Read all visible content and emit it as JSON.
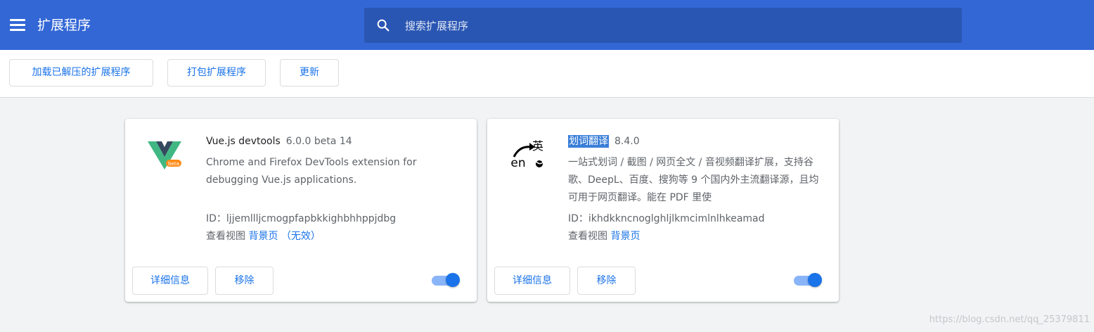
{
  "header": {
    "title": "扩展程序",
    "search_placeholder": "搜索扩展程序"
  },
  "toolbar": {
    "load_unpacked": "加载已解压的扩展程序",
    "pack": "打包扩展程序",
    "update": "更新"
  },
  "extensions": [
    {
      "name": "Vue.js devtools",
      "version": "6.0.0 beta 14",
      "description": "Chrome and Firefox DevTools extension for debugging Vue.js applications.",
      "id_label": "ID：",
      "id": "ljjemllljcmogpfapbkkighbhhppjdbg",
      "inspect_label": "查看视图",
      "bg_link": "背景页",
      "bg_status": "（无效）",
      "details_label": "详细信息",
      "remove_label": "移除",
      "enabled": true,
      "logo_badge": "beta"
    },
    {
      "name": "划词翻译",
      "version": "8.4.0",
      "description": "一站式划词 / 截图 / 网页全文 / 音视频翻译扩展，支持谷歌、DeepL、百度、搜狗等 9 个国内外主流翻译源，且均可用于网页翻译。能在 PDF 里使",
      "id_label": "ID：",
      "id": "ikhdkkncnoglghljlkmcimlnlhkeamad",
      "inspect_label": "查看视图",
      "bg_link": "背景页",
      "details_label": "详细信息",
      "remove_label": "移除",
      "enabled": true,
      "logo_text_top": "英",
      "logo_text_bottom": "en"
    }
  ],
  "watermark": "https://blog.csdn.net/qq_25379811",
  "colors": {
    "header_bg": "#3367d6",
    "search_bg": "#2a56b3",
    "accent": "#1a73e8"
  }
}
